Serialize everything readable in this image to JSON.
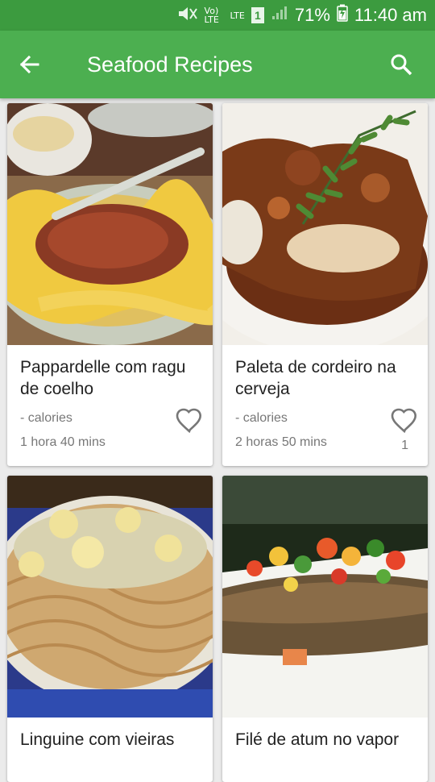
{
  "status_bar": {
    "battery": "71%",
    "time": "11:40 am",
    "network": "LTE",
    "volte": "Vo) LTE",
    "sim": "1"
  },
  "app_bar": {
    "title": "Seafood Recipes",
    "back_icon": "arrow-back-icon",
    "search_icon": "search-icon"
  },
  "recipes": [
    {
      "name": "Pappardelle com ragu de coelho",
      "calories": "- calories",
      "time": "1 hora 40 mins",
      "likes": ""
    },
    {
      "name": "Paleta de cordeiro na cerveja",
      "calories": "- calories",
      "time": "2 horas 50 mins",
      "likes": "1"
    },
    {
      "name": "Linguine com vieiras",
      "calories": "",
      "time": "",
      "likes": ""
    },
    {
      "name": "Filé de atum no vapor",
      "calories": "",
      "time": "",
      "likes": ""
    }
  ],
  "colors": {
    "primary": "#4caf50",
    "primary_dark": "#3c9b3f"
  }
}
